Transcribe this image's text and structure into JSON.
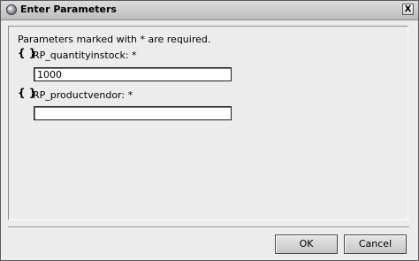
{
  "dialog": {
    "title": "Enter Parameters",
    "close_label": "X",
    "required_note": "Parameters marked with * are required."
  },
  "params": [
    {
      "icon": "{ }",
      "label": "RP_quantityinstock: *",
      "value": "1000"
    },
    {
      "icon": "{ }",
      "label": "RP_productvendor: *",
      "value": ""
    }
  ],
  "buttons": {
    "ok": "OK",
    "cancel": "Cancel"
  }
}
